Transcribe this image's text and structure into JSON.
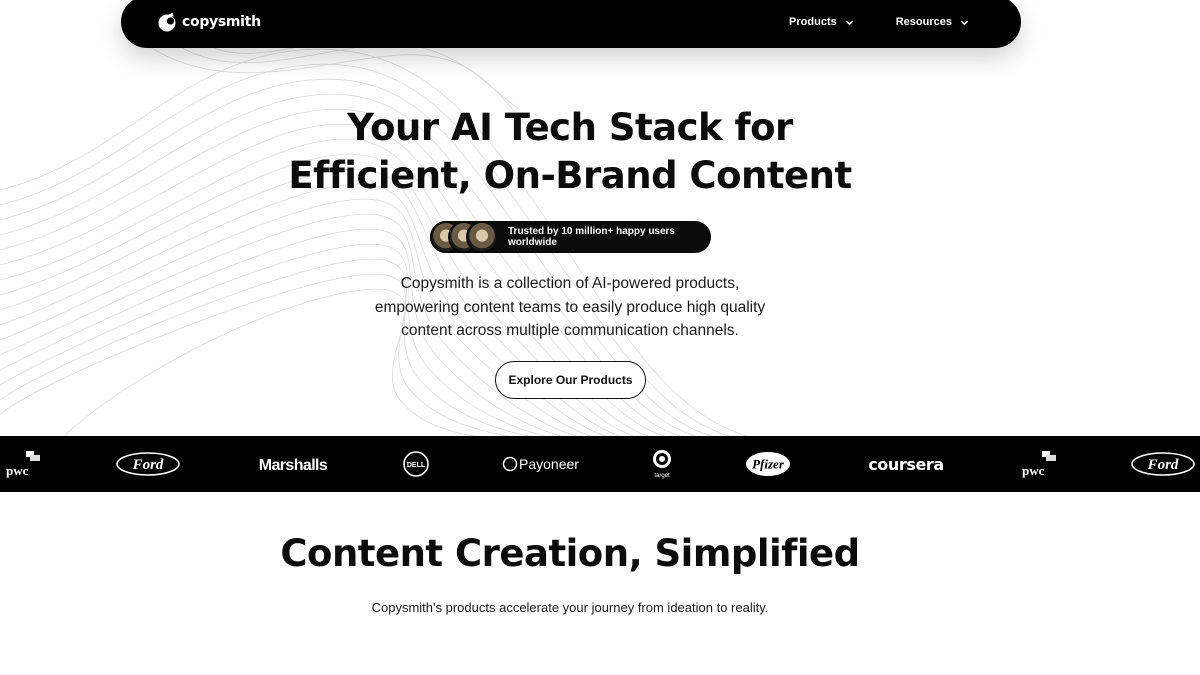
{
  "nav": {
    "logo_text": "copysmith",
    "items": [
      {
        "label": "Products"
      },
      {
        "label": "Resources"
      }
    ]
  },
  "hero": {
    "title_line1": "Your AI Tech Stack for",
    "title_line2": "Efficient, On-Brand Content",
    "trust_text": "Trusted by 10 million+ happy users worldwide",
    "desc_line1": "Copysmith is a collection of AI-powered products,",
    "desc_line2": "empowering content teams to easily produce high quality",
    "desc_line3": "content across multiple communication channels.",
    "cta_label": "Explore Our Products"
  },
  "logos": {
    "brands": [
      "pwc",
      "Ford",
      "Marshalls",
      "DELL",
      "Payoneer",
      "target",
      "Pfizer",
      "coursera",
      "pwc",
      "Ford"
    ]
  },
  "section2": {
    "title": "Content Creation, Simplified",
    "subtitle": "Copysmith's products accelerate your journey from ideation to reality."
  },
  "colors": {
    "primary": "#000000",
    "background": "#ffffff",
    "text": "#111111"
  }
}
